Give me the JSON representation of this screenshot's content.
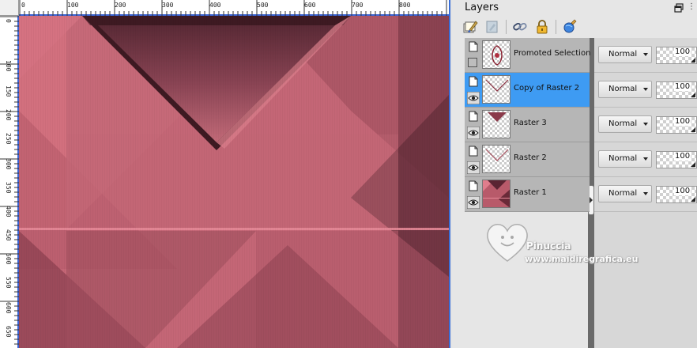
{
  "palette": {
    "title": "Layers"
  },
  "ruler": {
    "top_labels": [
      "0",
      "100",
      "200",
      "300",
      "400",
      "500",
      "600",
      "700",
      "800"
    ],
    "left_labels": [
      "0",
      "100",
      "150",
      "200",
      "250",
      "300",
      "350",
      "400",
      "450",
      "500",
      "550",
      "600",
      "650"
    ]
  },
  "layers": [
    {
      "name": "Promoted Selection",
      "blend_mode": "Normal",
      "opacity": "100",
      "visible": false,
      "selected": false
    },
    {
      "name": "Copy of Raster 2",
      "blend_mode": "Normal",
      "opacity": "100",
      "visible": true,
      "selected": true
    },
    {
      "name": "Raster 3",
      "blend_mode": "Normal",
      "opacity": "100",
      "visible": true,
      "selected": false
    },
    {
      "name": "Raster 2",
      "blend_mode": "Normal",
      "opacity": "100",
      "visible": true,
      "selected": false
    },
    {
      "name": "Raster 1",
      "blend_mode": "Normal",
      "opacity": "100",
      "visible": true,
      "selected": false
    }
  ],
  "watermark": {
    "name": "Pinuccia",
    "url": "www.maidiregrafica.eu"
  },
  "colors": {
    "canvas_pink": "#c86878",
    "canvas_dark": "#7a3a48",
    "selection_blue": "#3e9bf3",
    "ruler_accent": "#3b64d6"
  }
}
